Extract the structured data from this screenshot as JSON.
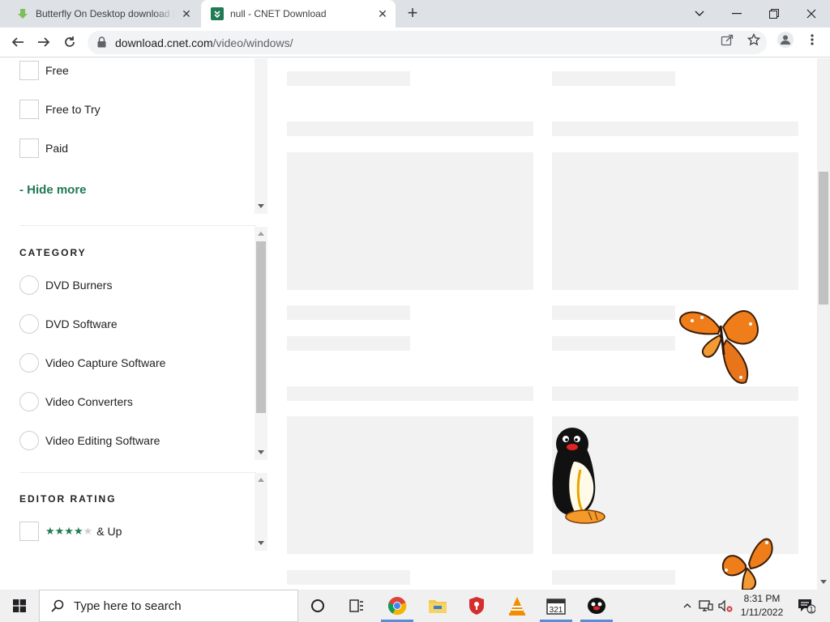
{
  "browser": {
    "tabs": [
      {
        "title": "Butterfly On Desktop download |",
        "icon": "download-arrow-icon"
      },
      {
        "title": "null - CNET Download",
        "icon": "cnet-favicon"
      }
    ],
    "new_tab_label": "+",
    "window_controls": {
      "dropdown": "⌄",
      "minimize": "—",
      "restore": "❐",
      "close": "✕"
    },
    "url_host": "download.cnet.com",
    "url_path": "/video/windows/"
  },
  "sidebar": {
    "license_filters": [
      {
        "label": "Free"
      },
      {
        "label": "Free to Try"
      },
      {
        "label": "Paid"
      }
    ],
    "hide_more": "-  Hide more",
    "category_title": "CATEGORY",
    "categories": [
      {
        "label": "DVD Burners"
      },
      {
        "label": "DVD Software"
      },
      {
        "label": "Video Capture Software"
      },
      {
        "label": "Video Converters"
      },
      {
        "label": "Video Editing Software"
      }
    ],
    "rating_title": "EDITOR RATING",
    "rating_option": {
      "stars_filled": 4,
      "stars_total": 5,
      "label": "& Up"
    }
  },
  "taskbar": {
    "search_placeholder": "Type here to search",
    "apps": [
      "task-view-icon",
      "chrome-icon",
      "file-explorer-icon",
      "shield-app-icon",
      "vlc-icon",
      "calendar-app-icon",
      "pingu-app-icon"
    ],
    "time": "8:31 PM",
    "date": "1/11/2022",
    "notification_count": "1"
  },
  "colors": {
    "accent_green": "#1f7a55",
    "skeleton": "#f2f2f2",
    "tab_strip": "#dee1e6"
  }
}
